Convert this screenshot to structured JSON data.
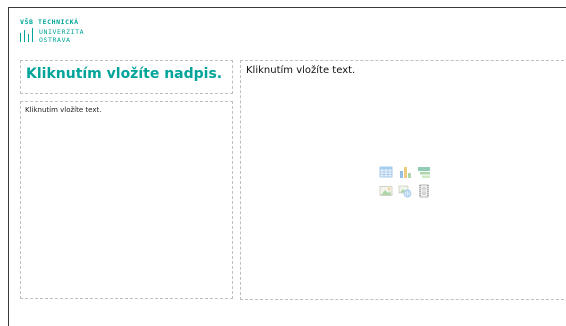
{
  "logo": {
    "line1": "VŠB TECHNICKÁ",
    "line2": "UNIVERZITA",
    "line3": "OSTRAVA",
    "brand_color": "#00a499"
  },
  "placeholders": {
    "title": "Kliknutím vložíte nadpis.",
    "left_text": "Kliknutím vložíte text.",
    "right_text": "Kliknutím vložíte text."
  },
  "content_icons": [
    "insert-table-icon",
    "insert-chart-icon",
    "insert-smartart-icon",
    "insert-picture-icon",
    "insert-online-picture-icon",
    "insert-video-icon"
  ]
}
